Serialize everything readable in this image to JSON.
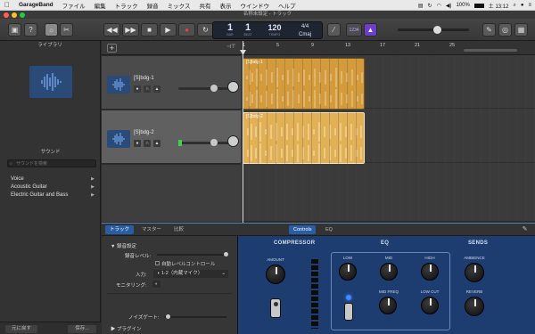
{
  "menubar": {
    "app": "GarageBand",
    "items": [
      "ファイル",
      "編集",
      "トラック",
      "録音",
      "ミックス",
      "共有",
      "表示",
      "ウインドウ",
      "ヘルプ"
    ],
    "battery": "100%",
    "clock": "土 13:12"
  },
  "window": {
    "title": "名称未設定 - トラック"
  },
  "lcd": {
    "bar": "1",
    "bar_label": "BAR",
    "beat": "1",
    "beat_label": "BEAT",
    "tempo": "120",
    "tempo_label": "TEMPO",
    "signature": "4/4",
    "key": "Cmaj"
  },
  "toolbar": {
    "count_in": "1234"
  },
  "library": {
    "title": "ライブラリ",
    "sound_title": "サウンド",
    "search_placeholder": "サウンドを検索",
    "items": [
      "Voice",
      "Acoustic Guitar",
      "Electric Guitar and Bass"
    ],
    "footer_revert": "元に戻す",
    "footer_save": "保存..."
  },
  "ruler": {
    "ticks": [
      "1",
      "5",
      "9",
      "13",
      "17",
      "21",
      "25"
    ]
  },
  "tracks": [
    {
      "name": "[S]bdg-1",
      "region": "[S]bdg-1",
      "volume": 0.72
    },
    {
      "name": "[S]bdg-2",
      "region": "[S]bdg-2",
      "volume": 0.72
    }
  ],
  "editor": {
    "tabs": [
      "トラック",
      "マスター",
      "比較"
    ],
    "plugin_tabs": [
      "Controls",
      "EQ"
    ],
    "section_recording": "録音設定",
    "rec_level_label": "録音レベル:",
    "auto_level": "自動レベルコントロール",
    "input_label": "入力:",
    "input_value": "1-2（内蔵マイク）",
    "monitoring_label": "モニタリング:",
    "noise_gate_label": "ノイズゲート:",
    "plugins_label": "プラグイン"
  },
  "plugin": {
    "compressor": "COMPRESSOR",
    "eq": "EQ",
    "sends": "SENDS",
    "knobs": {
      "amount": "AMOUNT",
      "low": "LOW",
      "mid": "MID",
      "high": "HIGH",
      "mid_freq": "MID FREQ",
      "low_cut": "LOW CUT",
      "ambience": "AMBIENCE",
      "reverb": "REVERB"
    }
  }
}
